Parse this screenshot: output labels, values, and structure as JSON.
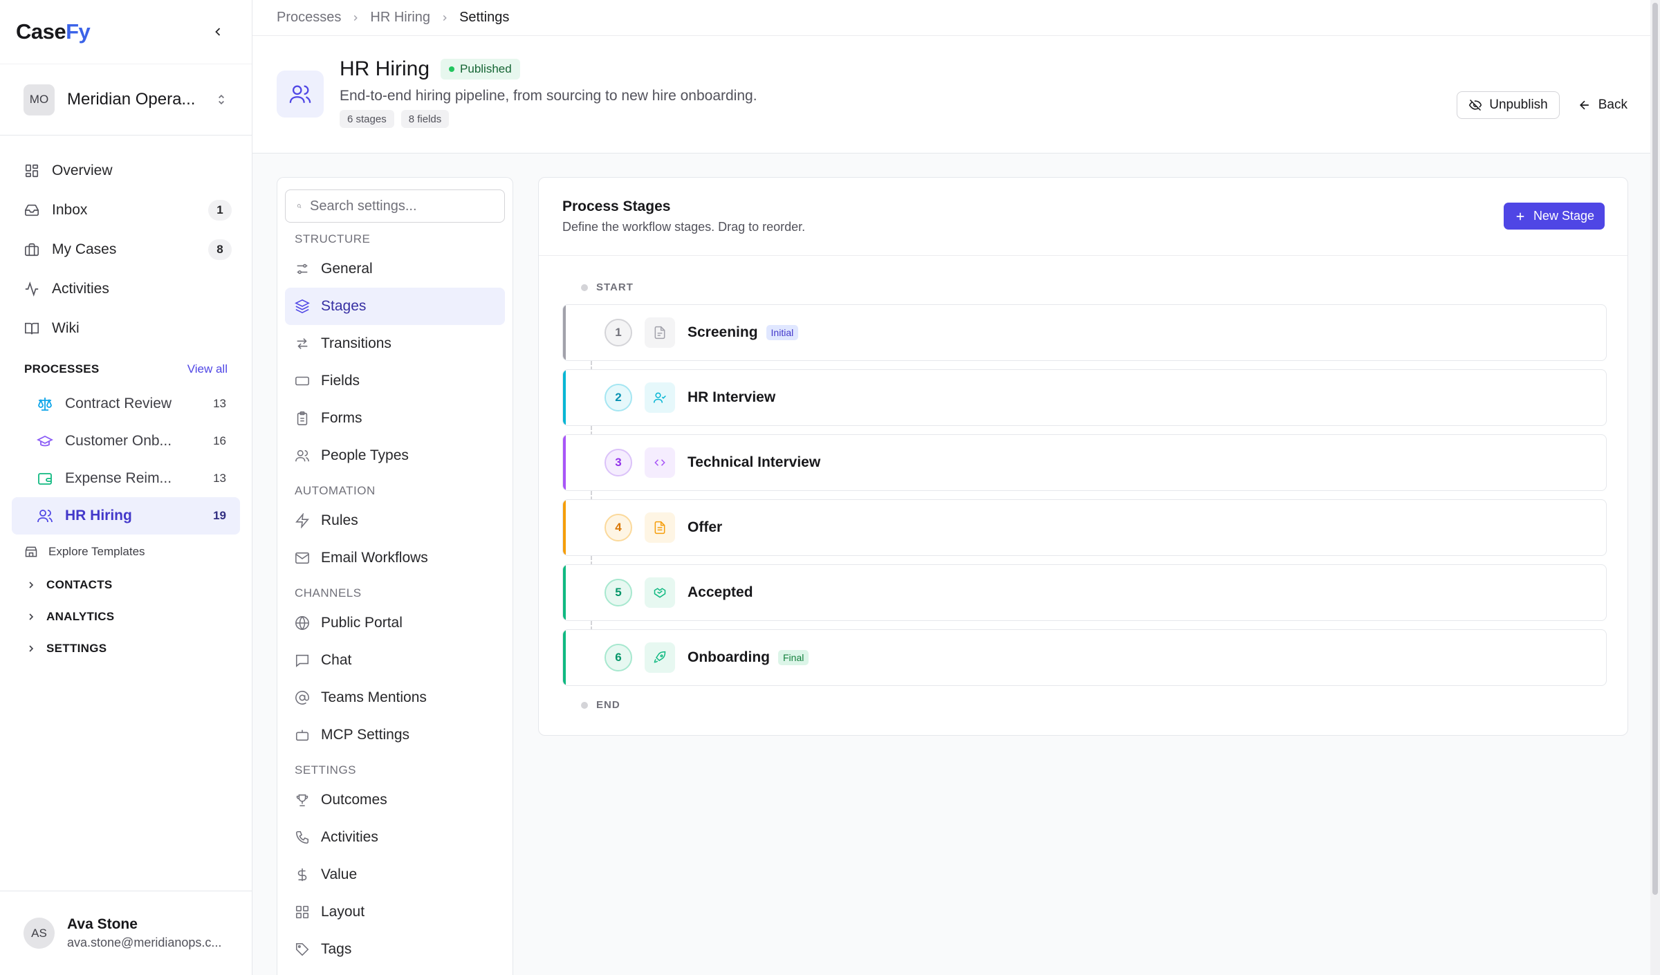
{
  "app": {
    "logo_case": "Case",
    "logo_fy": "Fy"
  },
  "workspace": {
    "initials": "MO",
    "name": "Meridian Opera..."
  },
  "nav": [
    {
      "label": "Overview",
      "icon": "grid-icon",
      "count": ""
    },
    {
      "label": "Inbox",
      "icon": "inbox-icon",
      "count": "1"
    },
    {
      "label": "My Cases",
      "icon": "briefcase-icon",
      "count": "8"
    },
    {
      "label": "Activities",
      "icon": "activity-icon",
      "count": ""
    },
    {
      "label": "Wiki",
      "icon": "book-icon",
      "count": ""
    }
  ],
  "processes": {
    "title": "PROCESSES",
    "view_all": "View all",
    "items": [
      {
        "label": "Contract Review",
        "count": "13",
        "icon": "scale-icon",
        "color": "#0ea5e9"
      },
      {
        "label": "Customer Onb...",
        "count": "16",
        "icon": "graduation-cap-icon",
        "color": "#8b5cf6"
      },
      {
        "label": "Expense Reim...",
        "count": "13",
        "icon": "wallet-icon",
        "color": "#10b981"
      },
      {
        "label": "HR Hiring",
        "count": "19",
        "icon": "users-icon",
        "color": "#4f46e5"
      }
    ],
    "explore": "Explore Templates"
  },
  "groups": [
    "CONTACTS",
    "ANALYTICS",
    "SETTINGS"
  ],
  "user": {
    "initials": "AS",
    "name": "Ava Stone",
    "email": "ava.stone@meridianops.c..."
  },
  "breadcrumb": [
    "Processes",
    "HR Hiring",
    "Settings"
  ],
  "header": {
    "title": "HR Hiring",
    "status": "Published",
    "description": "End-to-end hiring pipeline, from sourcing to new hire onboarding.",
    "tags": [
      "6 stages",
      "8 fields"
    ],
    "unpublish": "Unpublish",
    "back": "Back"
  },
  "settings_nav": {
    "search_placeholder": "Search settings...",
    "sections": [
      {
        "title": "STRUCTURE",
        "items": [
          {
            "label": "General",
            "icon": "sliders-icon"
          },
          {
            "label": "Stages",
            "icon": "layers-icon",
            "active": true
          },
          {
            "label": "Transitions",
            "icon": "arrows-icon"
          },
          {
            "label": "Fields",
            "icon": "input-icon"
          },
          {
            "label": "Forms",
            "icon": "clipboard-icon"
          },
          {
            "label": "People Types",
            "icon": "users-icon"
          }
        ]
      },
      {
        "title": "AUTOMATION",
        "items": [
          {
            "label": "Rules",
            "icon": "zap-icon"
          },
          {
            "label": "Email Workflows",
            "icon": "mail-icon"
          }
        ]
      },
      {
        "title": "CHANNELS",
        "items": [
          {
            "label": "Public Portal",
            "icon": "globe-icon"
          },
          {
            "label": "Chat",
            "icon": "message-icon"
          },
          {
            "label": "Teams Mentions",
            "icon": "at-sign-icon"
          },
          {
            "label": "MCP Settings",
            "icon": "bot-icon"
          }
        ]
      },
      {
        "title": "SETTINGS",
        "items": [
          {
            "label": "Outcomes",
            "icon": "trophy-icon"
          },
          {
            "label": "Activities",
            "icon": "phone-icon"
          },
          {
            "label": "Value",
            "icon": "dollar-icon"
          },
          {
            "label": "Layout",
            "icon": "grid-icon"
          },
          {
            "label": "Tags",
            "icon": "tag-icon"
          }
        ]
      }
    ]
  },
  "stages_panel": {
    "title": "Process Stages",
    "subtitle": "Define the workflow stages. Drag to reorder.",
    "new_stage": "New Stage",
    "start": "START",
    "end": "END",
    "stages": [
      {
        "num": "1",
        "name": "Screening",
        "badge": "Initial",
        "icon": "file-icon",
        "color": "#a1a1aa"
      },
      {
        "num": "2",
        "name": "HR Interview",
        "badge": "",
        "icon": "user-check-icon",
        "color": "#06b6d4"
      },
      {
        "num": "3",
        "name": "Technical Interview",
        "badge": "",
        "icon": "code-icon",
        "color": "#a855f7"
      },
      {
        "num": "4",
        "name": "Offer",
        "badge": "",
        "icon": "file-text-icon",
        "color": "#f59e0b"
      },
      {
        "num": "5",
        "name": "Accepted",
        "badge": "",
        "icon": "handshake-icon",
        "color": "#10b981"
      },
      {
        "num": "6",
        "name": "Onboarding",
        "badge": "Final",
        "icon": "rocket-icon",
        "color": "#10b981"
      }
    ]
  }
}
